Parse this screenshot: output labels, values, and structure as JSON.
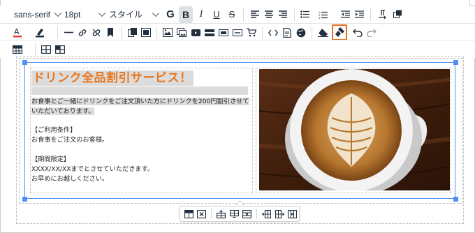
{
  "toolbar": {
    "font_family": "sans-serif",
    "font_size": "18pt",
    "style_label": "スタイル",
    "highlight_color": "#ea6c1f",
    "text_color": "#e03e2d"
  },
  "content": {
    "heading": "ドリンク全品割引サービス！",
    "heading_color": "#e8761e",
    "intro_line1": "お食事とご一緒にドリンクをご注文頂いた方にドリンクを200円割引させて",
    "intro_line2": "いただいております。",
    "conditions_title": "【ご利用条件】",
    "conditions_text": "お食事をご注文のお客様。",
    "period_title": "【期間限定】",
    "period_text": "XXXX/XX/XXまでとさせていただきます。",
    "closing": "お早めにお越しください。"
  },
  "image": {
    "subject": "latte-art coffee cup on wooden table"
  },
  "icons": {
    "bold": "bold-icon",
    "italic": "italic-icon",
    "underline": "underline-icon",
    "strike": "strikethrough-icon",
    "clear_format": "eraser-icon",
    "format_painter": "format-painter-icon"
  }
}
